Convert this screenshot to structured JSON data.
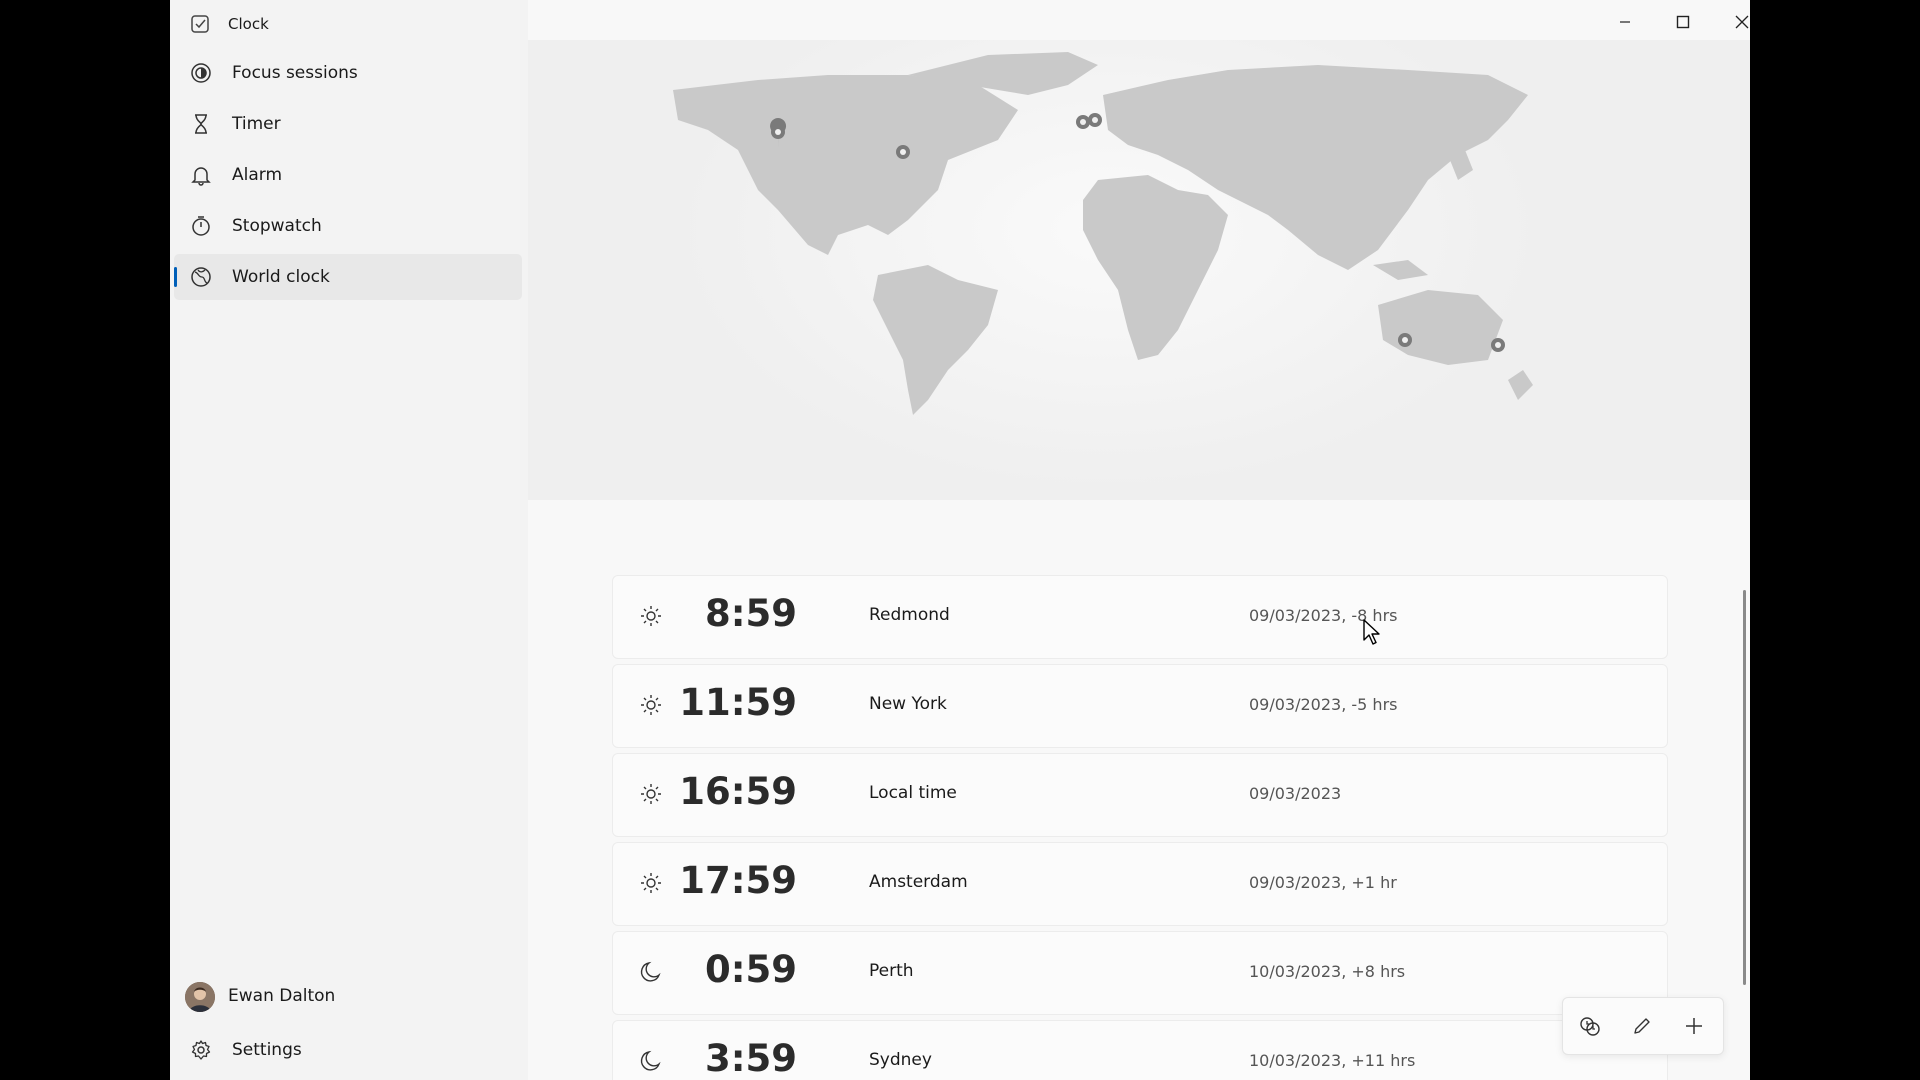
{
  "app": {
    "title": "Clock"
  },
  "nav": {
    "items": [
      {
        "label": "Focus sessions",
        "icon": "focus-icon"
      },
      {
        "label": "Timer",
        "icon": "hourglass-icon"
      },
      {
        "label": "Alarm",
        "icon": "bell-icon"
      },
      {
        "label": "Stopwatch",
        "icon": "stopwatch-icon"
      },
      {
        "label": "World clock",
        "icon": "globe-icon",
        "selected": true
      }
    ]
  },
  "user": {
    "name": "Ewan Dalton"
  },
  "settings": {
    "label": "Settings"
  },
  "clocks": [
    {
      "time": "8:59",
      "city": "Redmond",
      "meta": "09/03/2023, -8 hrs",
      "state": "sun-icon"
    },
    {
      "time": "11:59",
      "city": "New York",
      "meta": "09/03/2023, -5 hrs",
      "state": "sun-icon"
    },
    {
      "time": "16:59",
      "city": "Local time",
      "meta": "09/03/2023",
      "state": "sun-icon"
    },
    {
      "time": "17:59",
      "city": "Amsterdam",
      "meta": "09/03/2023, +1 hr",
      "state": "sun-icon"
    },
    {
      "time": "0:59",
      "city": "Perth",
      "meta": "10/03/2023, +8 hrs",
      "state": "moon-icon"
    },
    {
      "time": "3:59",
      "city": "Sydney",
      "meta": "10/03/2023, +11 hrs",
      "state": "moon-icon"
    }
  ],
  "colors": {
    "accent": "#005fb8",
    "map_land": "#c9c9c9",
    "pin": "#7a7a7a"
  }
}
